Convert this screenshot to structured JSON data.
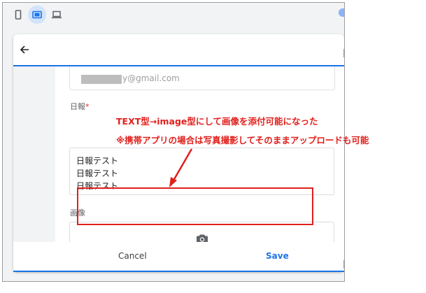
{
  "device_bar": {
    "devices": [
      {
        "name": "mobile",
        "icon": "phone-icon",
        "active": false
      },
      {
        "name": "tablet",
        "icon": "tablet-icon",
        "active": true
      },
      {
        "name": "desktop",
        "icon": "laptop-icon",
        "active": false
      }
    ]
  },
  "form": {
    "email_value": "y@gmail.com",
    "report_label": "日報",
    "required_mark": "*",
    "report_lines": [
      "日報テスト",
      "日報テスト",
      "日報テスト"
    ],
    "image_label": "画像"
  },
  "footer": {
    "cancel_label": "Cancel",
    "save_label": "Save"
  },
  "annotation": {
    "line1": "TEXT型→image型にして画像を添付可能になった",
    "line2": "※携帯アプリの場合は写真撮影してそのままアップロードも可能"
  },
  "colors": {
    "accent": "#1a73e8",
    "annotation": "#e0201c",
    "device_active_bg": "#d2e3fc"
  }
}
